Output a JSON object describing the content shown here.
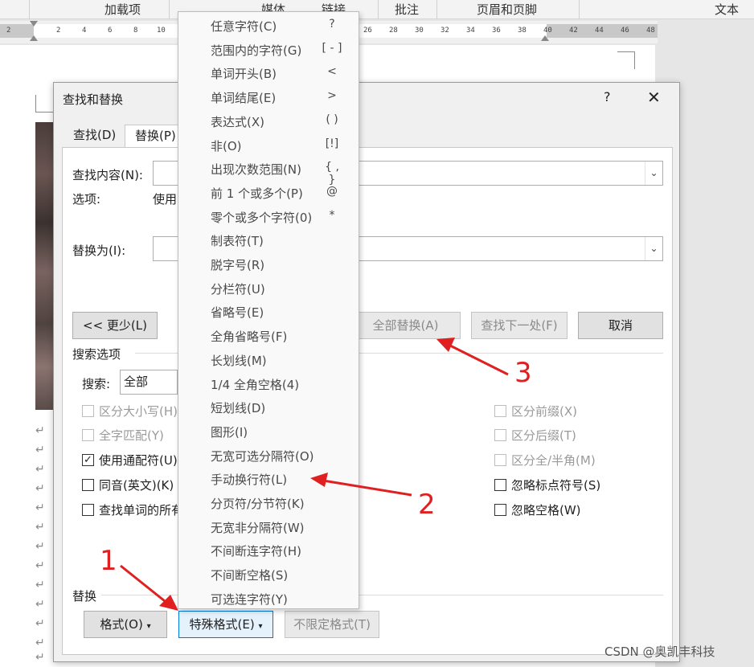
{
  "ribbon": {
    "tabs": [
      "加载项",
      "媒体",
      "链接",
      "批注",
      "页眉和页脚",
      "文本"
    ]
  },
  "ruler": {
    "numbers": [
      "2",
      "2",
      "4",
      "6",
      "8",
      "10",
      "26",
      "28",
      "30",
      "32",
      "34",
      "36",
      "38",
      "40",
      "42",
      "44",
      "46",
      "48"
    ]
  },
  "document": {
    "paragraph_mark": "↵"
  },
  "dialog": {
    "title": "查找和替换",
    "help": "?",
    "close": "✕",
    "tabs": [
      {
        "label": "查找(D)",
        "active": false
      },
      {
        "label": "替换(P)",
        "active": true
      }
    ],
    "find_label": "查找内容(N):",
    "options_label": "选项:",
    "options_value": "使用",
    "replace_label": "替换为(I):",
    "buttons": {
      "less": "<< 更少(L)",
      "replace_all": "全部替换(A)",
      "find_next": "查找下一处(F)",
      "cancel": "取消"
    },
    "search_options": {
      "group_label": "搜索选项",
      "search_label": "搜索:",
      "search_value": "全部",
      "left_checks": [
        {
          "label": "区分大小写(H)",
          "checked": false,
          "disabled": true
        },
        {
          "label": "全字匹配(Y)",
          "checked": false,
          "disabled": true
        },
        {
          "label": "使用通配符(U)",
          "checked": true,
          "disabled": false
        },
        {
          "label": "同音(英文)(K)",
          "checked": false,
          "disabled": false
        },
        {
          "label": "查找单词的所有",
          "checked": false,
          "disabled": false
        }
      ],
      "right_checks": [
        {
          "label": "区分前缀(X)",
          "checked": false,
          "disabled": true
        },
        {
          "label": "区分后缀(T)",
          "checked": false,
          "disabled": true
        },
        {
          "label": "区分全/半角(M)",
          "checked": false,
          "disabled": true
        },
        {
          "label": "忽略标点符号(S)",
          "checked": false,
          "disabled": false
        },
        {
          "label": "忽略空格(W)",
          "checked": false,
          "disabled": false
        }
      ]
    },
    "replace_group": {
      "label": "替换",
      "format_btn": "格式(O)",
      "special_btn": "特殊格式(E)",
      "no_format_btn": "不限定格式(T)"
    },
    "check_mark": "✓",
    "dropdown_arrow": "⌄",
    "menu_arrow": "▾"
  },
  "special_menu": {
    "items": [
      {
        "label": "任意字符(C)",
        "shortcut": "?"
      },
      {
        "label": "范围内的字符(G)",
        "shortcut": "[ - ]"
      },
      {
        "label": "单词开头(B)",
        "shortcut": "<"
      },
      {
        "label": "单词结尾(E)",
        "shortcut": ">"
      },
      {
        "label": "表达式(X)",
        "shortcut": "( )"
      },
      {
        "label": "非(O)",
        "shortcut": "[!]"
      },
      {
        "label": "出现次数范围(N)",
        "shortcut": "{ , }"
      },
      {
        "label": "前 1 个或多个(P)",
        "shortcut": "@"
      },
      {
        "label": "零个或多个字符(0)",
        "shortcut": "*"
      },
      {
        "label": "制表符(T)",
        "shortcut": ""
      },
      {
        "label": "脱字号(R)",
        "shortcut": ""
      },
      {
        "label": "分栏符(U)",
        "shortcut": ""
      },
      {
        "label": "省略号(E)",
        "shortcut": ""
      },
      {
        "label": "全角省略号(F)",
        "shortcut": ""
      },
      {
        "label": "长划线(M)",
        "shortcut": ""
      },
      {
        "label": "1/4 全角空格(4)",
        "shortcut": ""
      },
      {
        "label": "短划线(D)",
        "shortcut": ""
      },
      {
        "label": "图形(I)",
        "shortcut": ""
      },
      {
        "label": "无宽可选分隔符(O)",
        "shortcut": ""
      },
      {
        "label": "手动换行符(L)",
        "shortcut": ""
      },
      {
        "label": "分页符/分节符(K)",
        "shortcut": ""
      },
      {
        "label": "无宽非分隔符(W)",
        "shortcut": ""
      },
      {
        "label": "不间断连字符(H)",
        "shortcut": ""
      },
      {
        "label": "不间断空格(S)",
        "shortcut": ""
      },
      {
        "label": "可选连字符(Y)",
        "shortcut": ""
      }
    ]
  },
  "annotations": {
    "numbers": [
      "1",
      "2",
      "3"
    ],
    "color": "#e02020"
  },
  "watermark": "CSDN @奥凯丰科技"
}
